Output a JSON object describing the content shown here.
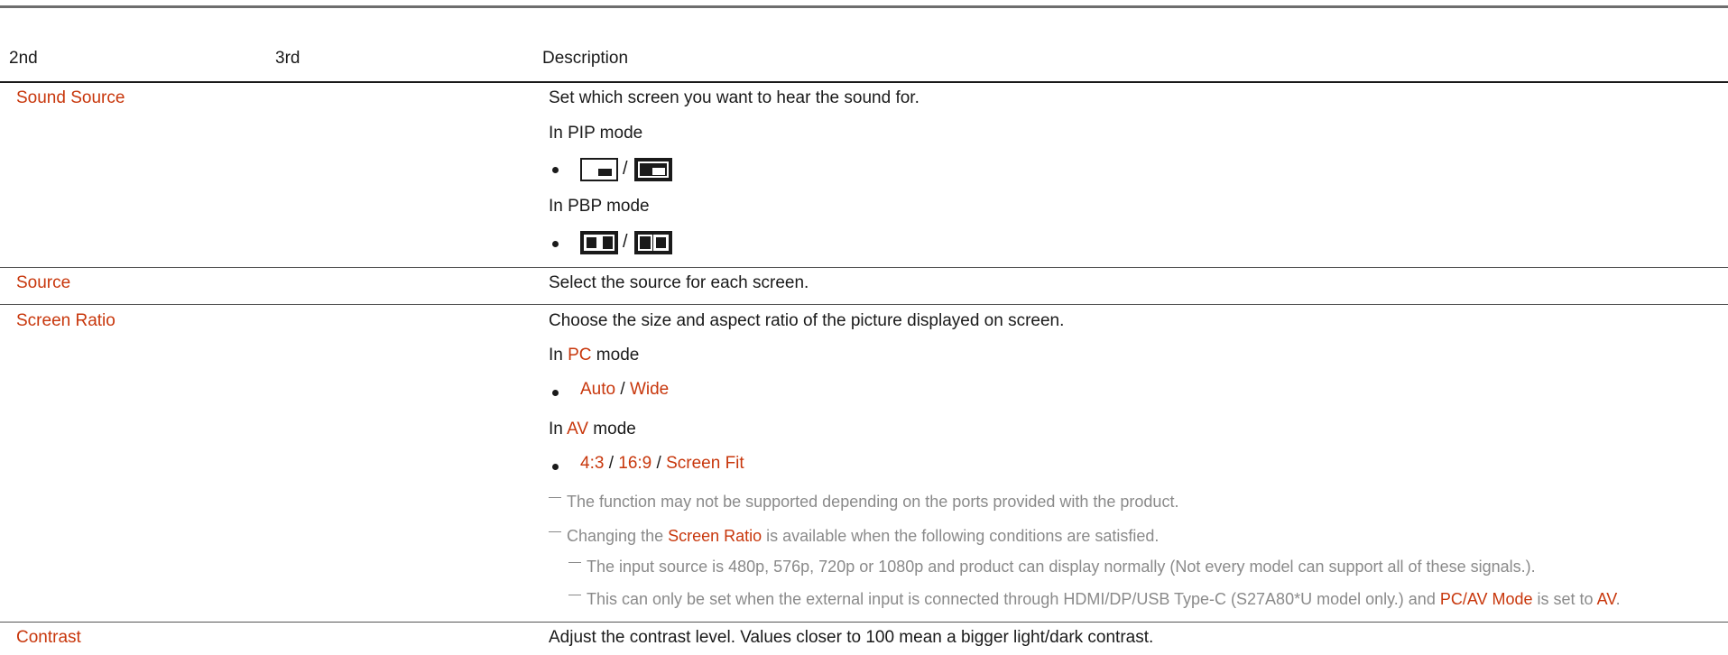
{
  "header": {
    "col2": "2nd",
    "col3": "3rd",
    "col_desc": "Description"
  },
  "rows": {
    "sound_source": {
      "name": "Sound Source",
      "desc": "Set which screen you want to hear the sound for.",
      "pip_label": "In PIP mode",
      "pbp_label": "In PBP mode",
      "slash": "/"
    },
    "source": {
      "name": "Source",
      "desc": "Select the source for each screen."
    },
    "screen_ratio": {
      "name": "Screen Ratio",
      "desc": "Choose the size and aspect ratio of the picture displayed on screen.",
      "pc_prefix": "In ",
      "pc_term": "PC",
      "pc_suffix": " mode",
      "pc_options": [
        "Auto",
        "Wide"
      ],
      "av_prefix": "In ",
      "av_term": "AV",
      "av_suffix": " mode",
      "av_options": [
        "4:3",
        "16:9",
        "Screen Fit"
      ],
      "sep": " / ",
      "note1": "The function may not be supported depending on the ports provided with the product.",
      "note2_prefix": "Changing the ",
      "note2_term": "Screen Ratio",
      "note2_suffix": " is available when the following conditions are satisfied.",
      "sub1": "The input source is 480p, 576p, 720p or 1080p and product can display normally (Not every model can support all of these signals.).",
      "sub2_prefix": "This can only be set when the external input is connected through HDMI/DP/USB Type-C (S27A80*U model only.) and ",
      "sub2_term": "PC/AV Mode",
      "sub2_mid": " is set to ",
      "sub2_term2": "AV",
      "sub2_end": "."
    },
    "contrast": {
      "name": "Contrast",
      "desc": "Adjust the contrast level. Values closer to 100 mean a bigger light/dark contrast."
    }
  },
  "colors": {
    "accent": "#c8370c",
    "note_gray": "#8a8a8a",
    "text": "#1a1a1a"
  }
}
